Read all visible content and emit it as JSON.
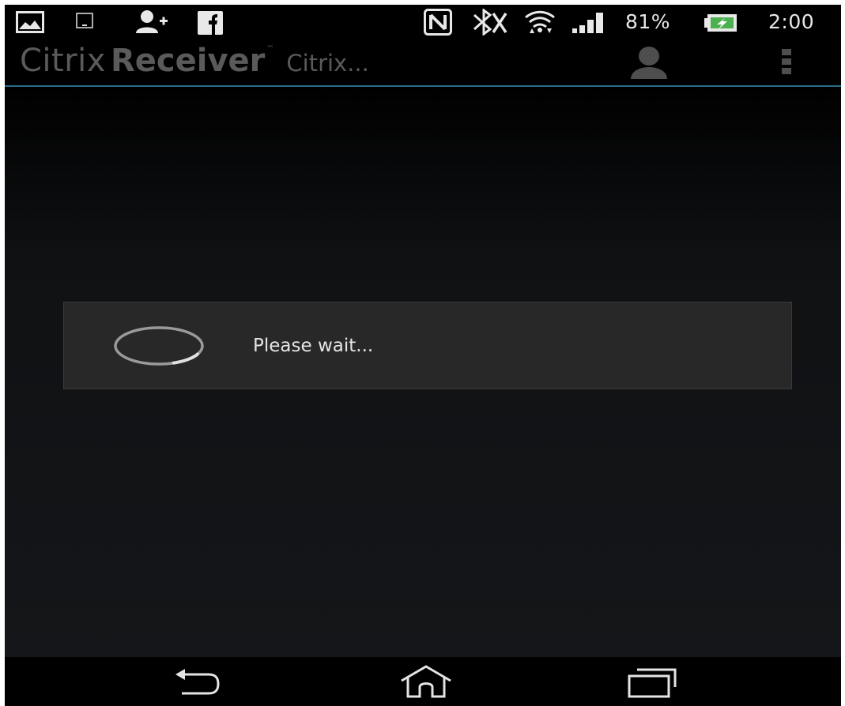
{
  "status_bar": {
    "battery_percent": "81%",
    "time": "2:00",
    "icons": [
      "gallery-icon",
      "tablet-icon",
      "add-contact-icon",
      "facebook-icon",
      "nfc-icon",
      "bluetooth-off-icon",
      "wifi-icon",
      "signal-icon",
      "battery-charging-icon"
    ]
  },
  "action_bar": {
    "logo_citrix": "Citrix",
    "logo_receiver": "Receiver",
    "logo_tm": "™",
    "store_name": "Citrix...",
    "icons": [
      "account-icon",
      "overflow-menu-icon"
    ]
  },
  "dialog": {
    "message": "Please wait...",
    "spinner_progress": 0.2
  },
  "nav_bar": {
    "icons": [
      "back-icon",
      "home-icon",
      "recent-apps-icon"
    ]
  },
  "colors": {
    "background": "#000000",
    "accent_line": "#2a6e88",
    "dialog_bg": "#282828",
    "title_text": "#5a5a5a"
  }
}
